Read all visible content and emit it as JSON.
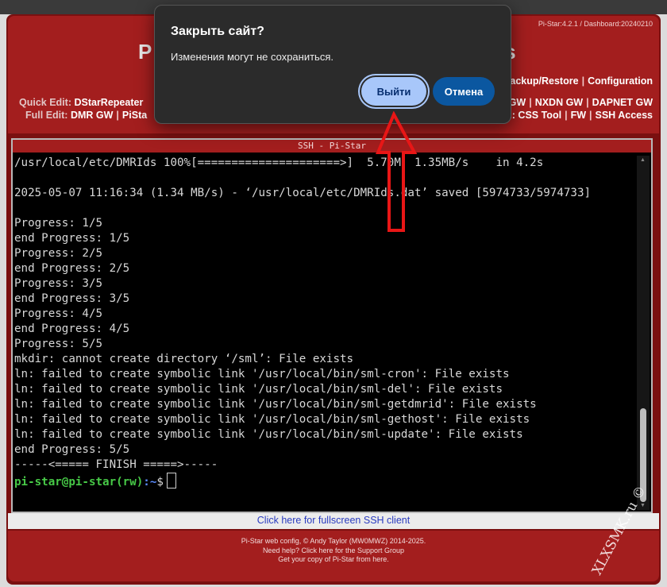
{
  "header": {
    "version": "Pi-Star:4.2.1 / Dashboard:20240210",
    "title_left_fragment": "Pi",
    "title_right_fragment": "rs",
    "menu_right": [
      "ackup/Restore",
      "Configuration"
    ],
    "quick_edit_label": "Quick Edit:",
    "quick_edit_left": "DStarRepeater",
    "quick_edit_right": [
      "GW",
      "NXDN GW",
      "DAPNET GW"
    ],
    "full_edit_label": "Full Edit:",
    "full_edit_left": "DMR GW",
    "full_edit_left_cut": "PiSta",
    "full_edit_right": [
      "CSS Tool",
      "FW",
      "SSH Access"
    ],
    "full_edit_right_prefix": "l:"
  },
  "ssh": {
    "title": "SSH - Pi-Star",
    "lines": [
      "/usr/local/etc/DMRIds 100%[=====================>]  5.70M  1.35MB/s    in 4.2s",
      "",
      "2025-05-07 11:16:34 (1.34 MB/s) - ‘/usr/local/etc/DMRIds.dat’ saved [5974733/5974733]",
      "",
      "Progress: 1/5",
      "end Progress: 1/5",
      "Progress: 2/5",
      "end Progress: 2/5",
      "Progress: 3/5",
      "end Progress: 3/5",
      "Progress: 4/5",
      "end Progress: 4/5",
      "Progress: 5/5",
      "mkdir: cannot create directory ‘/sml’: File exists",
      "ln: failed to create symbolic link '/usr/local/bin/sml-cron': File exists",
      "ln: failed to create symbolic link '/usr/local/bin/sml-del': File exists",
      "ln: failed to create symbolic link '/usr/local/bin/sml-getdmrid': File exists",
      "ln: failed to create symbolic link '/usr/local/bin/sml-gethost': File exists",
      "ln: failed to create symbolic link '/usr/local/bin/sml-update': File exists",
      "end Progress: 5/5",
      "-----<===== FINISH =====>-----"
    ],
    "prompt_user": "pi-star@pi-star(rw)",
    "prompt_path": ":~",
    "prompt_symbol": "$"
  },
  "fullscreen_link": "Click here for fullscreen SSH client",
  "footer": {
    "line1": "Pi-Star web config, © Andy Taylor (MW0MWZ) 2014-2025.",
    "line2": "Need help? Click here for the Support Group",
    "line3": "Get your copy of Pi-Star from here."
  },
  "watermark": "XLXSMK.ru ©",
  "dialog": {
    "title": "Закрыть сайт?",
    "message": "Изменения могут не сохраниться.",
    "exit_label": "Выйти",
    "cancel_label": "Отмена"
  },
  "colors": {
    "header_red": "#a31e1e",
    "frame_red": "#7a1010",
    "prompt_user": "#47c947",
    "prompt_path": "#5b8cff",
    "dialog_bg": "#2b2b2b",
    "exit_button": "#a8c7fa",
    "cancel_button": "#0b57a0",
    "arrow": "#e81616"
  }
}
